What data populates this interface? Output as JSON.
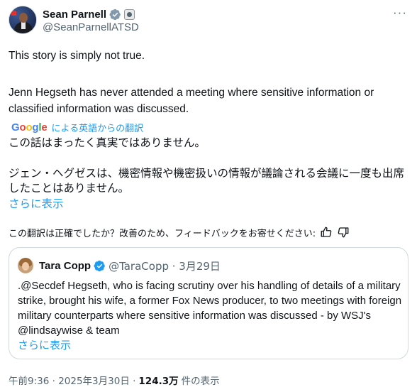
{
  "author": {
    "display_name": "Sean Parnell",
    "handle": "@SeanParnellATSD",
    "more_glyph": "···"
  },
  "tweet": {
    "line1": "This story is simply not true.",
    "line2": "Jenn Hegseth has never attended a meeting where sensitive information or classified information was discussed."
  },
  "translation": {
    "google_letters": [
      "G",
      "o",
      "o",
      "g",
      "l",
      "e"
    ],
    "label": "による英語からの翻訳",
    "jp1": "この話はまったく真実ではありません。",
    "jp2": "ジェン・ヘグゼスは、機密情報や機密扱いの情報が議論される会議に一度も出席したことはありません。",
    "show_more": "さらに表示",
    "feedback_question": "この翻訳は正確でしたか？改善のため、フィードバックをお寄せください:"
  },
  "quote": {
    "display_name": "Tara Copp",
    "handle_date": "@TaraCopp · 3月29日",
    "text": ".@Secdef Hegseth, who is facing scrutiny over his handling of details of a military strike, brought his wife, a former Fox News producer, to two meetings with foreign military counterparts where sensitive information was discussed - by WSJ's @lindsaywise & team",
    "show_more": "さらに表示"
  },
  "meta": {
    "timestamp": "午前9:36 · 2025年3月30日 ·",
    "views_count": "124.3万",
    "views_label": "件の表示"
  },
  "colors": {
    "accent": "#1d9bf0",
    "text": "#0f1419",
    "muted": "#536471",
    "border": "#cfd9de"
  },
  "icons": {
    "verified": "verified-badge-icon",
    "government": "government-affiliation-icon",
    "thumbs_up": "thumbs-up-icon",
    "thumbs_down": "thumbs-down-icon",
    "more": "more-dots-icon"
  }
}
